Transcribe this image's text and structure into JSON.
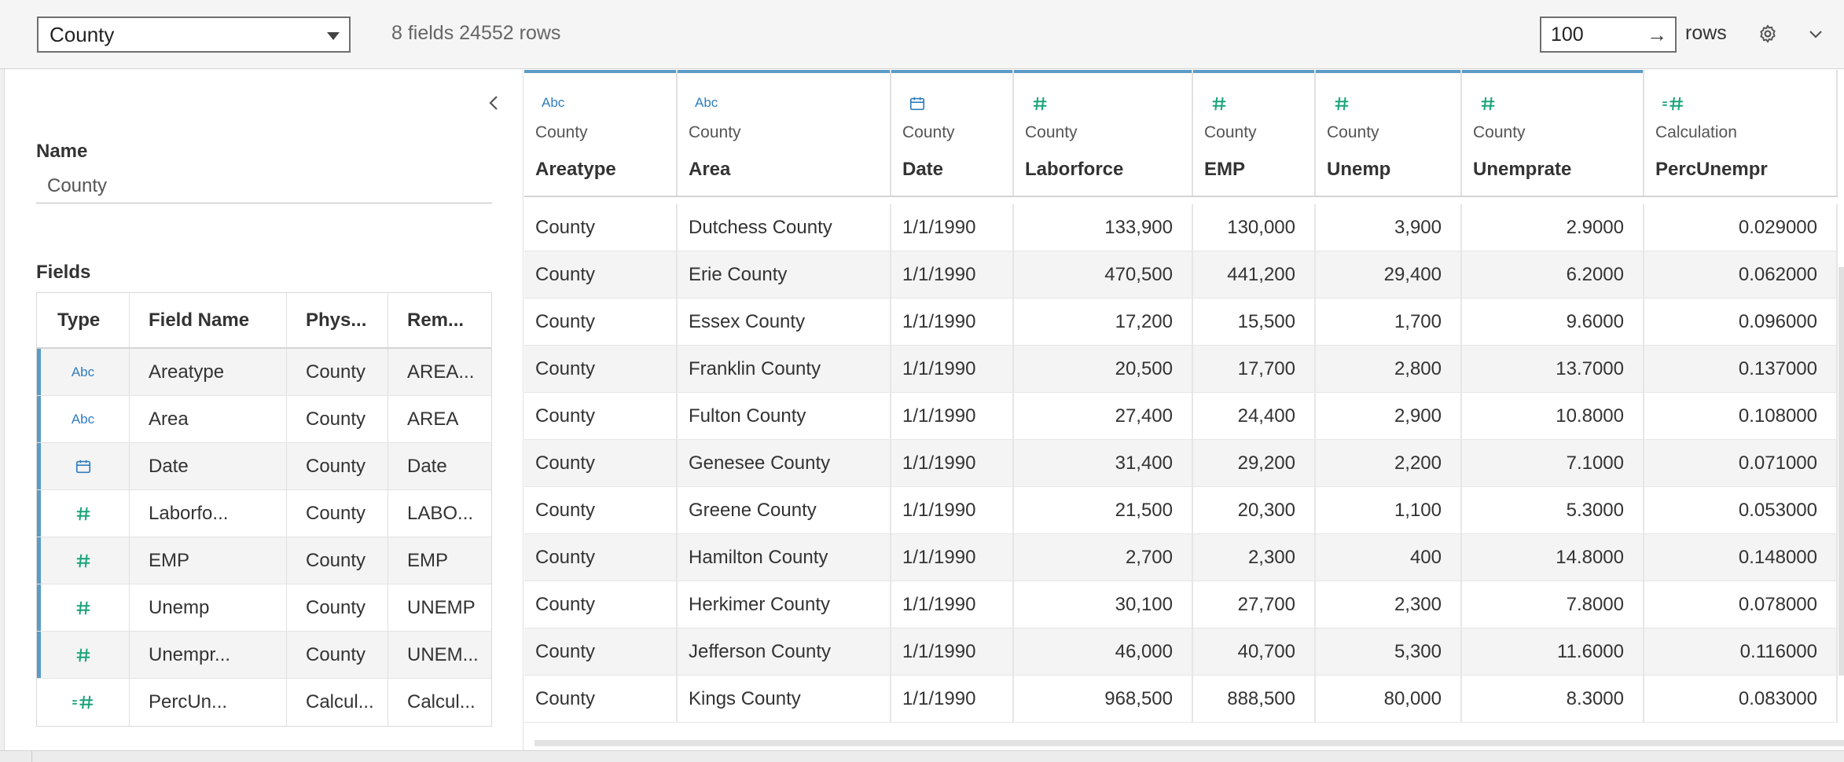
{
  "toolbar": {
    "table_select": "County",
    "field_summary": "8 fields 24552 rows",
    "rows_value": "100",
    "rows_label": "rows"
  },
  "metadata": {
    "name_heading": "Name",
    "name_value": "County",
    "fields_heading": "Fields",
    "columns": [
      "Type",
      "Field Name",
      "Phys...",
      "Rem..."
    ],
    "fields": [
      {
        "type_icon": "string-abc-icon",
        "type_text": "Abc",
        "name": "Areatype",
        "physical": "County",
        "remote": "AREA..."
      },
      {
        "type_icon": "string-abc-icon",
        "type_text": "Abc",
        "name": "Area",
        "physical": "County",
        "remote": "AREA"
      },
      {
        "type_icon": "calendar-date-icon",
        "type_text": "",
        "name": "Date",
        "physical": "County",
        "remote": "Date"
      },
      {
        "type_icon": "number-hash-icon",
        "type_text": "",
        "name": "Laborfo...",
        "physical": "County",
        "remote": "LABO..."
      },
      {
        "type_icon": "number-hash-icon",
        "type_text": "",
        "name": "EMP",
        "physical": "County",
        "remote": "EMP"
      },
      {
        "type_icon": "number-hash-icon",
        "type_text": "",
        "name": "Unemp",
        "physical": "County",
        "remote": "UNEMP"
      },
      {
        "type_icon": "number-hash-icon",
        "type_text": "",
        "name": "Unempr...",
        "physical": "County",
        "remote": "UNEM..."
      },
      {
        "type_icon": "calculated-number-icon",
        "type_text": "",
        "name": "PercUn...",
        "physical": "Calcul...",
        "remote": "Calcul..."
      }
    ]
  },
  "grid": {
    "columns": [
      {
        "icon": "string-abc-icon",
        "icon_text": "Abc",
        "source": "County",
        "name": "Areatype",
        "align": "left"
      },
      {
        "icon": "string-abc-icon",
        "icon_text": "Abc",
        "source": "County",
        "name": "Area",
        "align": "left"
      },
      {
        "icon": "calendar-date-icon",
        "icon_text": "",
        "source": "County",
        "name": "Date",
        "align": "left"
      },
      {
        "icon": "number-hash-icon",
        "icon_text": "",
        "source": "County",
        "name": "Laborforce",
        "align": "right"
      },
      {
        "icon": "number-hash-icon",
        "icon_text": "",
        "source": "County",
        "name": "EMP",
        "align": "right"
      },
      {
        "icon": "number-hash-icon",
        "icon_text": "",
        "source": "County",
        "name": "Unemp",
        "align": "right"
      },
      {
        "icon": "number-hash-icon",
        "icon_text": "",
        "source": "County",
        "name": "Unemprate",
        "align": "right"
      },
      {
        "icon": "calculated-number-icon",
        "icon_text": "",
        "source": "Calculation",
        "name": "PercUnempr",
        "align": "right"
      }
    ],
    "rows": [
      [
        "County",
        "Dutchess County",
        "1/1/1990",
        "133,900",
        "130,000",
        "3,900",
        "2.9000",
        "0.029000"
      ],
      [
        "County",
        "Erie County",
        "1/1/1990",
        "470,500",
        "441,200",
        "29,400",
        "6.2000",
        "0.062000"
      ],
      [
        "County",
        "Essex County",
        "1/1/1990",
        "17,200",
        "15,500",
        "1,700",
        "9.6000",
        "0.096000"
      ],
      [
        "County",
        "Franklin County",
        "1/1/1990",
        "20,500",
        "17,700",
        "2,800",
        "13.7000",
        "0.137000"
      ],
      [
        "County",
        "Fulton County",
        "1/1/1990",
        "27,400",
        "24,400",
        "2,900",
        "10.8000",
        "0.108000"
      ],
      [
        "County",
        "Genesee County",
        "1/1/1990",
        "31,400",
        "29,200",
        "2,200",
        "7.1000",
        "0.071000"
      ],
      [
        "County",
        "Greene County",
        "1/1/1990",
        "21,500",
        "20,300",
        "1,100",
        "5.3000",
        "0.053000"
      ],
      [
        "County",
        "Hamilton County",
        "1/1/1990",
        "2,700",
        "2,300",
        "400",
        "14.8000",
        "0.148000"
      ],
      [
        "County",
        "Herkimer County",
        "1/1/1990",
        "30,100",
        "27,700",
        "2,300",
        "7.8000",
        "0.078000"
      ],
      [
        "County",
        "Jefferson County",
        "1/1/1990",
        "46,000",
        "40,700",
        "5,300",
        "11.6000",
        "0.116000"
      ],
      [
        "County",
        "Kings County",
        "1/1/1990",
        "968,500",
        "888,500",
        "80,000",
        "8.3000",
        "0.083000"
      ]
    ]
  },
  "colors": {
    "accent": "#5b9bc6",
    "string_icon": "#2f7dbd",
    "number_icon": "#1aa37a",
    "stripe": "#f4f4f4"
  }
}
